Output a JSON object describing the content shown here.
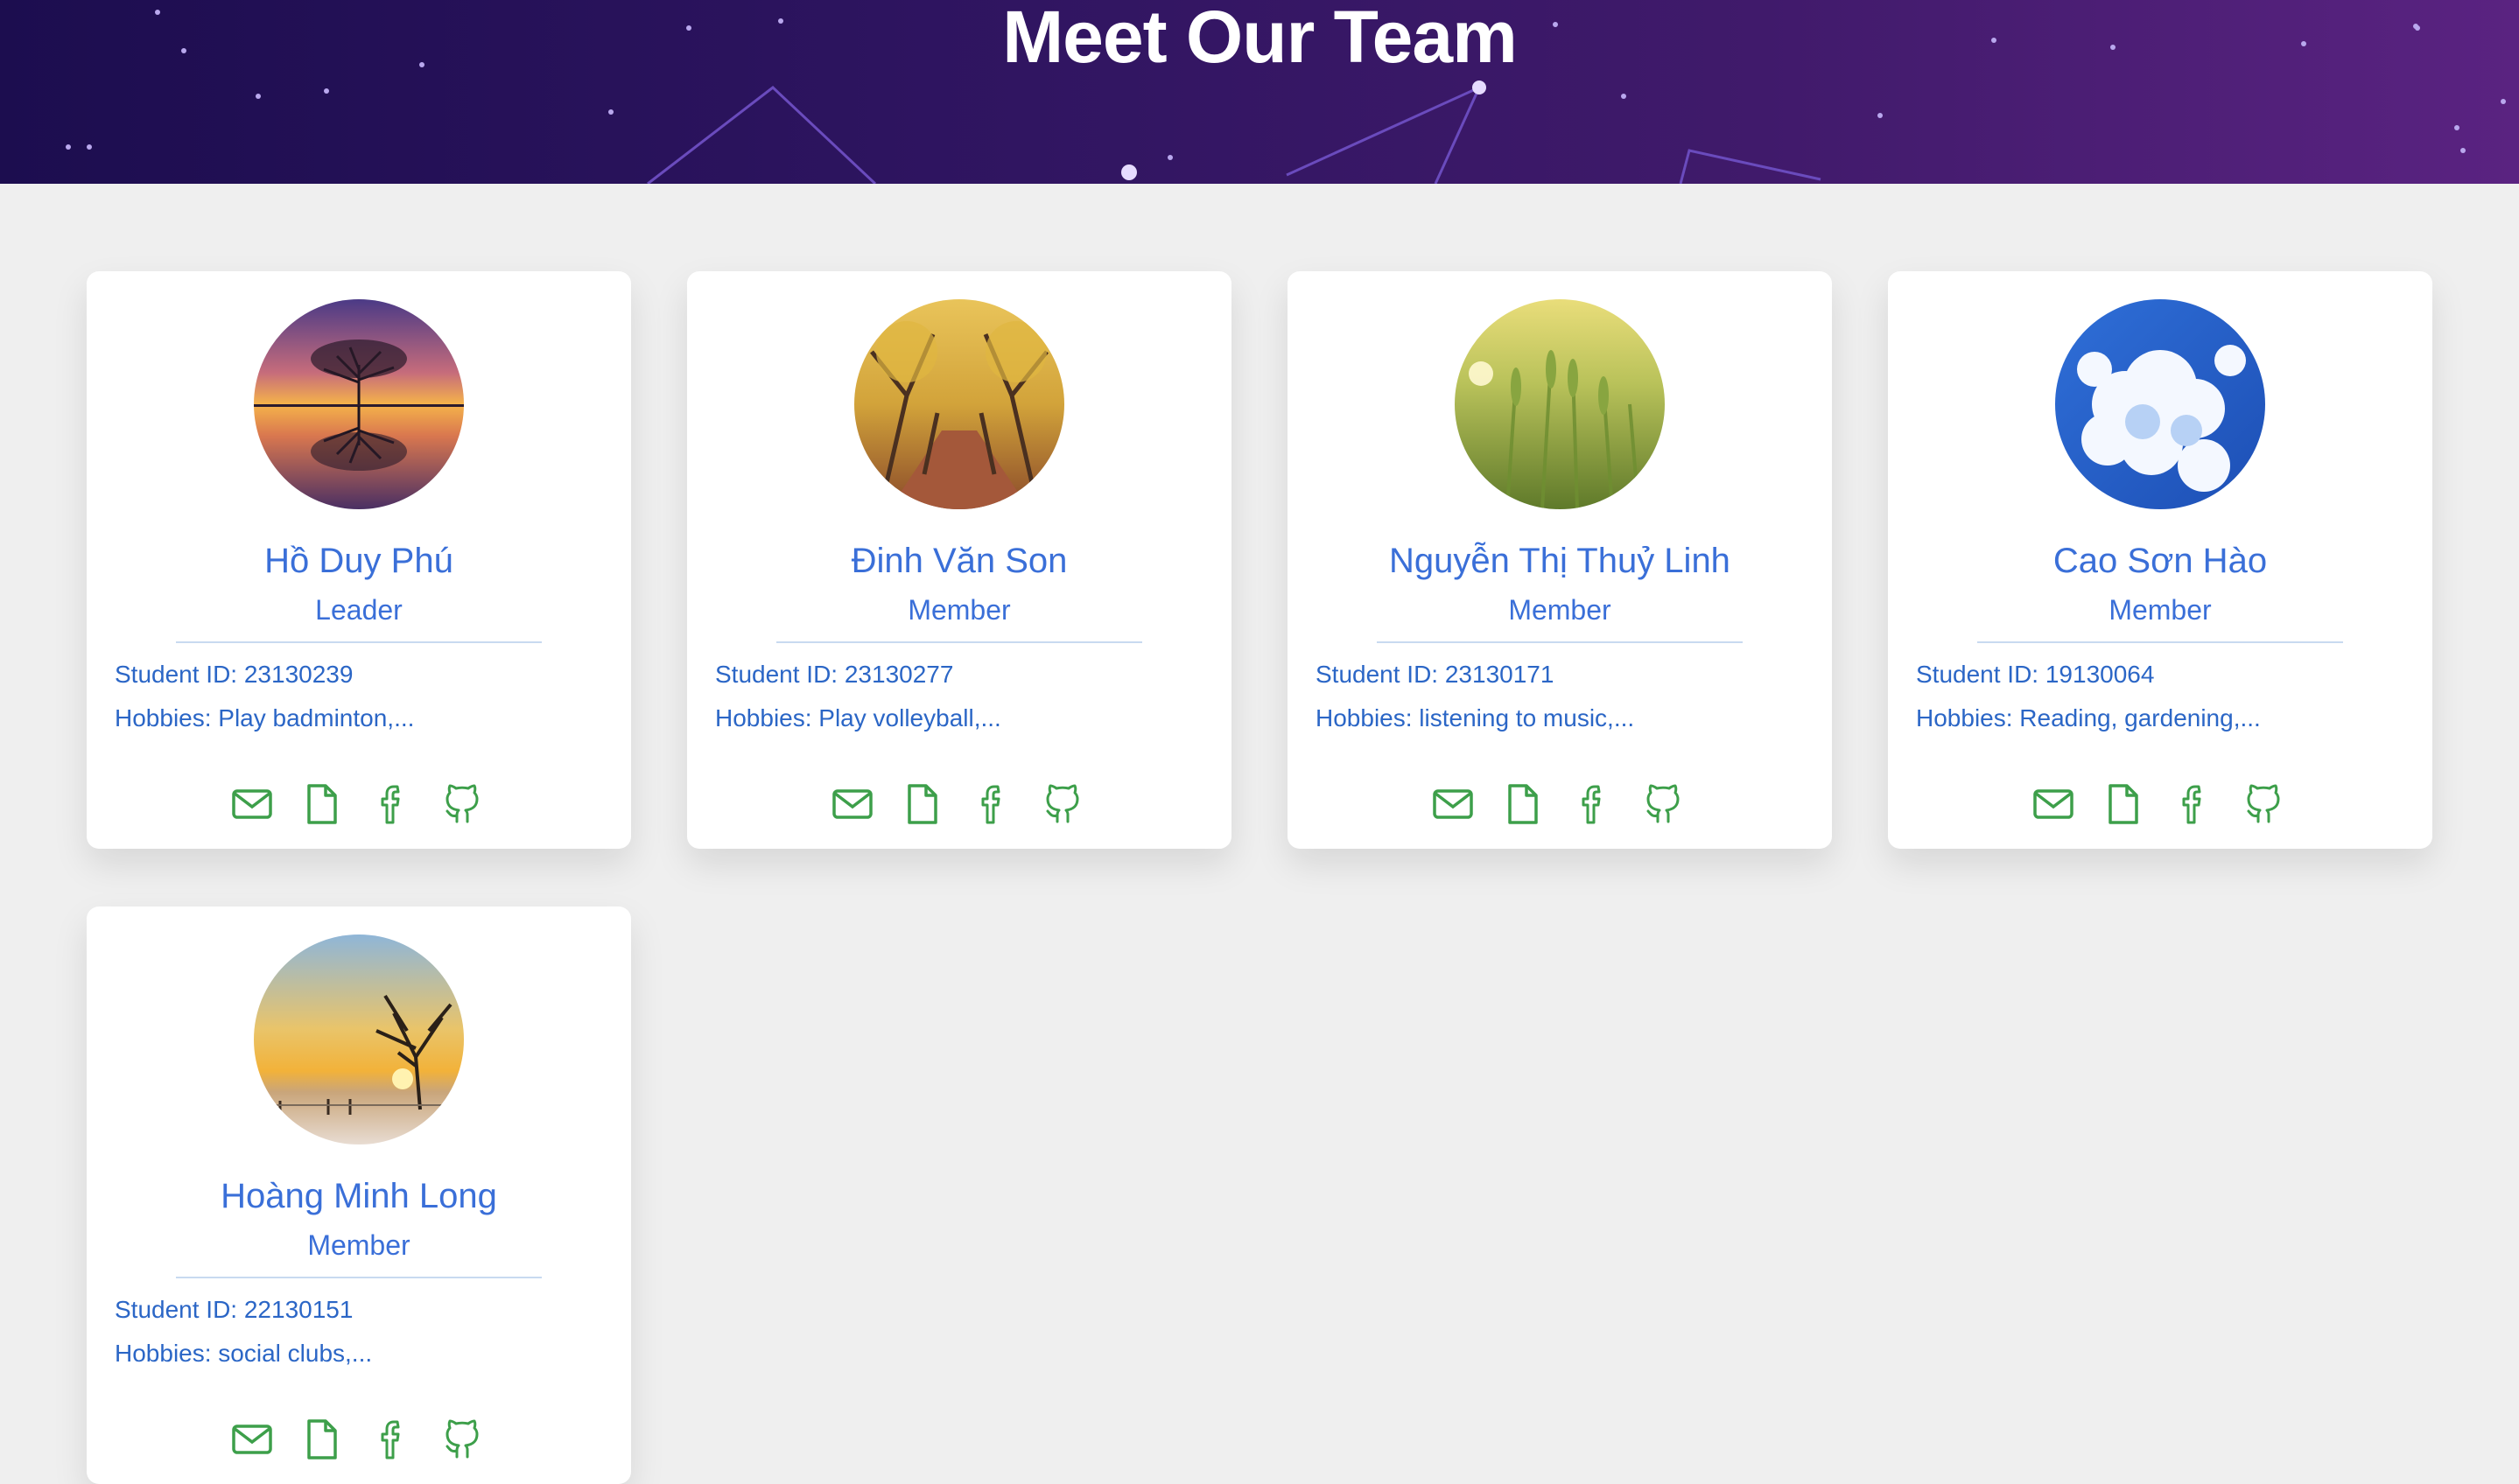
{
  "header": {
    "title": "Meet Our Team"
  },
  "colors": {
    "accent_blue": "#3a6fd8",
    "icon_green": "#3d9f4a",
    "hero_start": "#1c0d4f",
    "hero_end": "#5a2381"
  },
  "members": [
    {
      "name": "Hồ Duy Phú",
      "role": "Leader",
      "student_id": "Student ID: 23130239",
      "hobbies": "Hobbies: Play badminton,...",
      "avatar": "sunset-tree-photo",
      "links": [
        "mail-icon",
        "document-icon",
        "facebook-icon",
        "github-icon"
      ]
    },
    {
      "name": "Đinh Văn Son",
      "role": "Member",
      "student_id": "Student ID: 23130277",
      "hobbies": "Hobbies: Play volleyball,...",
      "avatar": "autumn-path-photo",
      "links": [
        "mail-icon",
        "document-icon",
        "facebook-icon",
        "github-icon"
      ]
    },
    {
      "name": "Nguyễn Thị Thuỷ Linh",
      "role": "Member",
      "student_id": "Student ID: 23130171",
      "hobbies": "Hobbies: listening to music,...",
      "avatar": "wheat-field-photo",
      "links": [
        "mail-icon",
        "document-icon",
        "facebook-icon",
        "github-icon"
      ]
    },
    {
      "name": "Cao Sơn Hào",
      "role": "Member",
      "student_id": "Student ID: 19130064",
      "hobbies": "Hobbies: Reading, gardening,...",
      "avatar": "sky-clouds-photo",
      "links": [
        "mail-icon",
        "document-icon",
        "facebook-icon",
        "github-icon"
      ]
    },
    {
      "name": "Hoàng Minh Long",
      "role": "Member",
      "student_id": "Student ID: 22130151",
      "hobbies": "Hobbies: social clubs,...",
      "avatar": "winter-tree-photo",
      "links": [
        "mail-icon",
        "document-icon",
        "facebook-icon",
        "github-icon"
      ]
    }
  ]
}
